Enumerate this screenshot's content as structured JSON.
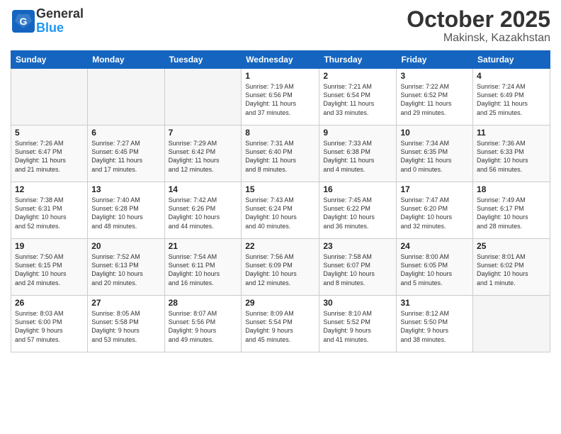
{
  "header": {
    "logo_general": "General",
    "logo_blue": "Blue",
    "month_title": "October 2025",
    "location": "Makinsk, Kazakhstan"
  },
  "weekdays": [
    "Sunday",
    "Monday",
    "Tuesday",
    "Wednesday",
    "Thursday",
    "Friday",
    "Saturday"
  ],
  "weeks": [
    [
      {
        "day": "",
        "content": ""
      },
      {
        "day": "",
        "content": ""
      },
      {
        "day": "",
        "content": ""
      },
      {
        "day": "1",
        "content": "Sunrise: 7:19 AM\nSunset: 6:56 PM\nDaylight: 11 hours\nand 37 minutes."
      },
      {
        "day": "2",
        "content": "Sunrise: 7:21 AM\nSunset: 6:54 PM\nDaylight: 11 hours\nand 33 minutes."
      },
      {
        "day": "3",
        "content": "Sunrise: 7:22 AM\nSunset: 6:52 PM\nDaylight: 11 hours\nand 29 minutes."
      },
      {
        "day": "4",
        "content": "Sunrise: 7:24 AM\nSunset: 6:49 PM\nDaylight: 11 hours\nand 25 minutes."
      }
    ],
    [
      {
        "day": "5",
        "content": "Sunrise: 7:26 AM\nSunset: 6:47 PM\nDaylight: 11 hours\nand 21 minutes."
      },
      {
        "day": "6",
        "content": "Sunrise: 7:27 AM\nSunset: 6:45 PM\nDaylight: 11 hours\nand 17 minutes."
      },
      {
        "day": "7",
        "content": "Sunrise: 7:29 AM\nSunset: 6:42 PM\nDaylight: 11 hours\nand 12 minutes."
      },
      {
        "day": "8",
        "content": "Sunrise: 7:31 AM\nSunset: 6:40 PM\nDaylight: 11 hours\nand 8 minutes."
      },
      {
        "day": "9",
        "content": "Sunrise: 7:33 AM\nSunset: 6:38 PM\nDaylight: 11 hours\nand 4 minutes."
      },
      {
        "day": "10",
        "content": "Sunrise: 7:34 AM\nSunset: 6:35 PM\nDaylight: 11 hours\nand 0 minutes."
      },
      {
        "day": "11",
        "content": "Sunrise: 7:36 AM\nSunset: 6:33 PM\nDaylight: 10 hours\nand 56 minutes."
      }
    ],
    [
      {
        "day": "12",
        "content": "Sunrise: 7:38 AM\nSunset: 6:31 PM\nDaylight: 10 hours\nand 52 minutes."
      },
      {
        "day": "13",
        "content": "Sunrise: 7:40 AM\nSunset: 6:28 PM\nDaylight: 10 hours\nand 48 minutes."
      },
      {
        "day": "14",
        "content": "Sunrise: 7:42 AM\nSunset: 6:26 PM\nDaylight: 10 hours\nand 44 minutes."
      },
      {
        "day": "15",
        "content": "Sunrise: 7:43 AM\nSunset: 6:24 PM\nDaylight: 10 hours\nand 40 minutes."
      },
      {
        "day": "16",
        "content": "Sunrise: 7:45 AM\nSunset: 6:22 PM\nDaylight: 10 hours\nand 36 minutes."
      },
      {
        "day": "17",
        "content": "Sunrise: 7:47 AM\nSunset: 6:20 PM\nDaylight: 10 hours\nand 32 minutes."
      },
      {
        "day": "18",
        "content": "Sunrise: 7:49 AM\nSunset: 6:17 PM\nDaylight: 10 hours\nand 28 minutes."
      }
    ],
    [
      {
        "day": "19",
        "content": "Sunrise: 7:50 AM\nSunset: 6:15 PM\nDaylight: 10 hours\nand 24 minutes."
      },
      {
        "day": "20",
        "content": "Sunrise: 7:52 AM\nSunset: 6:13 PM\nDaylight: 10 hours\nand 20 minutes."
      },
      {
        "day": "21",
        "content": "Sunrise: 7:54 AM\nSunset: 6:11 PM\nDaylight: 10 hours\nand 16 minutes."
      },
      {
        "day": "22",
        "content": "Sunrise: 7:56 AM\nSunset: 6:09 PM\nDaylight: 10 hours\nand 12 minutes."
      },
      {
        "day": "23",
        "content": "Sunrise: 7:58 AM\nSunset: 6:07 PM\nDaylight: 10 hours\nand 8 minutes."
      },
      {
        "day": "24",
        "content": "Sunrise: 8:00 AM\nSunset: 6:05 PM\nDaylight: 10 hours\nand 5 minutes."
      },
      {
        "day": "25",
        "content": "Sunrise: 8:01 AM\nSunset: 6:02 PM\nDaylight: 10 hours\nand 1 minute."
      }
    ],
    [
      {
        "day": "26",
        "content": "Sunrise: 8:03 AM\nSunset: 6:00 PM\nDaylight: 9 hours\nand 57 minutes."
      },
      {
        "day": "27",
        "content": "Sunrise: 8:05 AM\nSunset: 5:58 PM\nDaylight: 9 hours\nand 53 minutes."
      },
      {
        "day": "28",
        "content": "Sunrise: 8:07 AM\nSunset: 5:56 PM\nDaylight: 9 hours\nand 49 minutes."
      },
      {
        "day": "29",
        "content": "Sunrise: 8:09 AM\nSunset: 5:54 PM\nDaylight: 9 hours\nand 45 minutes."
      },
      {
        "day": "30",
        "content": "Sunrise: 8:10 AM\nSunset: 5:52 PM\nDaylight: 9 hours\nand 41 minutes."
      },
      {
        "day": "31",
        "content": "Sunrise: 8:12 AM\nSunset: 5:50 PM\nDaylight: 9 hours\nand 38 minutes."
      },
      {
        "day": "",
        "content": ""
      }
    ]
  ]
}
